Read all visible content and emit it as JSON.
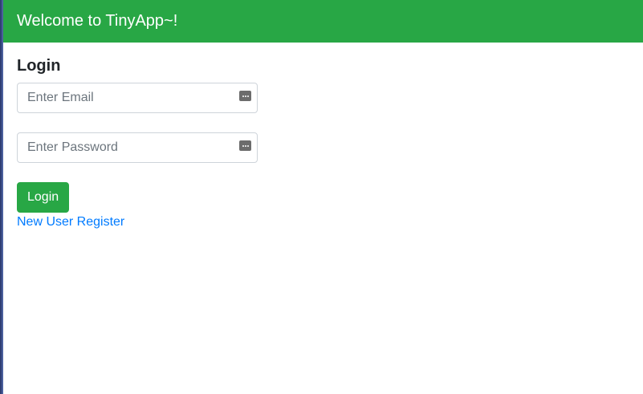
{
  "navbar": {
    "brand": "Welcome to TinyApp~!",
    "color": "#28a745"
  },
  "login": {
    "heading": "Login",
    "email": {
      "placeholder": "Enter Email",
      "value": "",
      "icon": "password-manager-key-icon"
    },
    "password": {
      "placeholder": "Enter Password",
      "value": "",
      "icon": "password-manager-key-icon"
    },
    "submit_label": "Login",
    "register_link": "New User Register"
  },
  "colors": {
    "accent": "#28a745",
    "link": "#007bff"
  }
}
